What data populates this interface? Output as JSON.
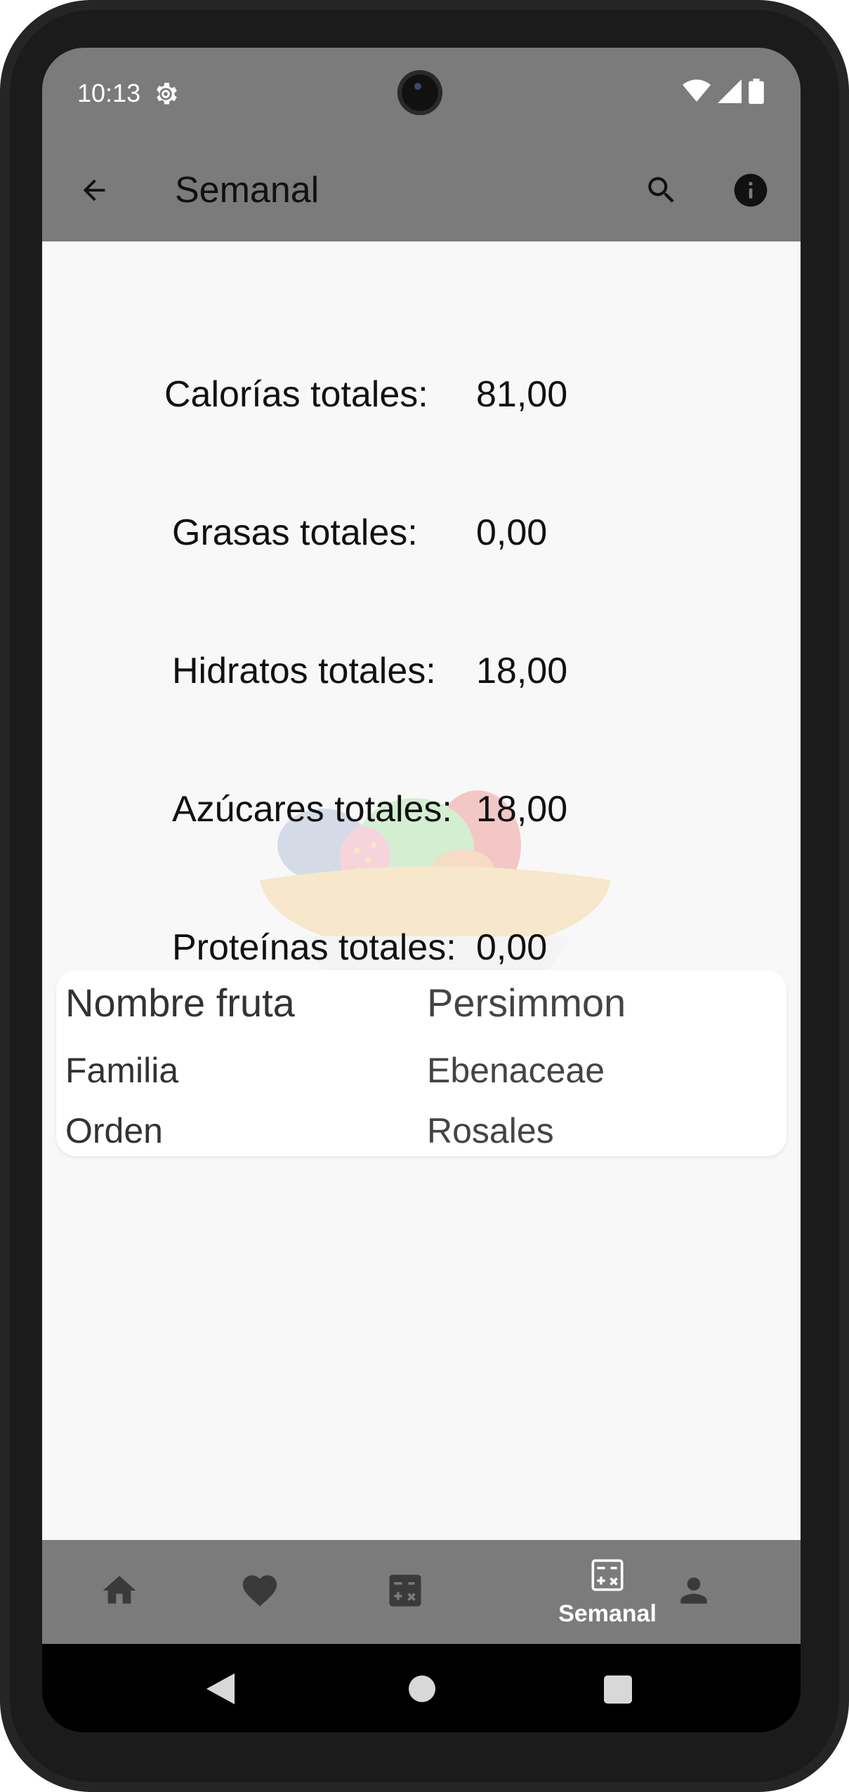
{
  "status_bar": {
    "time": "10:13",
    "icons": [
      "settings-gear-icon",
      "wifi-icon",
      "signal-icon",
      "battery-icon"
    ]
  },
  "toolbar": {
    "title": "Semanal",
    "icons": [
      "back-arrow-icon",
      "search-icon",
      "info-icon"
    ]
  },
  "stats": [
    {
      "label": "Calorías totales:",
      "value": "81,00"
    },
    {
      "label": "Grasas totales:",
      "value": "0,00"
    },
    {
      "label": "Hidratos totales:",
      "value": "18,00"
    },
    {
      "label": "Azúcares totales:",
      "value": "18,00"
    },
    {
      "label": "Proteínas totales:",
      "value": "0,00"
    }
  ],
  "fruit_card": {
    "rows": [
      {
        "key": "Nombre fruta",
        "value": "Persimmon"
      },
      {
        "key": "Familia",
        "value": "Ebenaceae"
      },
      {
        "key": "Orden",
        "value": "Rosales"
      }
    ]
  },
  "bottom_nav": {
    "items": [
      {
        "icon": "home-icon",
        "label": ""
      },
      {
        "icon": "heart-icon",
        "label": ""
      },
      {
        "icon": "calculator-icon",
        "label": ""
      },
      {
        "icon": "weekly-calculator-icon",
        "label": "Semanal",
        "selected": true
      },
      {
        "icon": "person-icon",
        "label": ""
      }
    ]
  },
  "colors": {
    "bars": "#7b7b7b",
    "background": "#f8f8f8",
    "card": "#ffffff"
  }
}
